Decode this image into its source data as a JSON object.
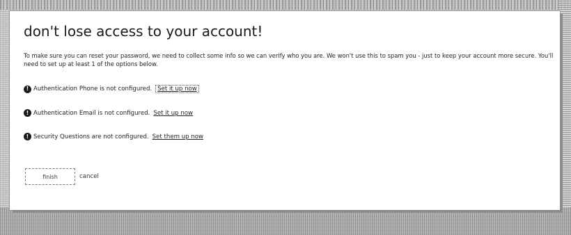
{
  "dialog": {
    "title": "don't lose access to your account!",
    "intro": "To make sure you can reset your password, we need to collect some info so we can verify who you are. We won't use this to spam you - just to keep your account more secure. You'll need to set up at least 1 of the options below.",
    "options": [
      {
        "badge": "!",
        "status": "Authentication Phone is not configured.",
        "action": "Set it up now"
      },
      {
        "badge": "!",
        "status": "Authentication Email is not configured.",
        "action": "Set it up now"
      },
      {
        "badge": "!",
        "status": "Security Questions are not configured.",
        "action": "Set them up now"
      }
    ],
    "finish_label": "finish",
    "cancel_label": "cancel"
  }
}
